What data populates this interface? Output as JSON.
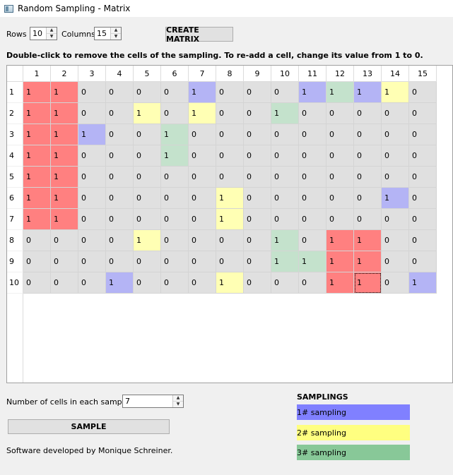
{
  "window": {
    "title": "Random Sampling - Matrix"
  },
  "controls": {
    "rows_label": "Rows",
    "rows_value": "10",
    "columns_label": "Columns",
    "columns_value": "15",
    "create_button": "CREATE MATRIX"
  },
  "instruction": "Double-click to remove the cells of the sampling. To re-add a cell, change its value from 1 to 0.",
  "table": {
    "column_headers": [
      "1",
      "2",
      "3",
      "4",
      "5",
      "6",
      "7",
      "8",
      "9",
      "10",
      "11",
      "12",
      "13",
      "14",
      "15"
    ],
    "row_headers": [
      "1",
      "2",
      "3",
      "4",
      "5",
      "6",
      "7",
      "8",
      "9",
      "10"
    ],
    "values": [
      [
        "1",
        "1",
        "0",
        "0",
        "0",
        "0",
        "1",
        "0",
        "0",
        "0",
        "1",
        "1",
        "1",
        "1",
        "0"
      ],
      [
        "1",
        "1",
        "0",
        "0",
        "1",
        "0",
        "1",
        "0",
        "0",
        "1",
        "0",
        "0",
        "0",
        "0",
        "0"
      ],
      [
        "1",
        "1",
        "1",
        "0",
        "0",
        "1",
        "0",
        "0",
        "0",
        "0",
        "0",
        "0",
        "0",
        "0",
        "0"
      ],
      [
        "1",
        "1",
        "0",
        "0",
        "0",
        "1",
        "0",
        "0",
        "0",
        "0",
        "0",
        "0",
        "0",
        "0",
        "0"
      ],
      [
        "1",
        "1",
        "0",
        "0",
        "0",
        "0",
        "0",
        "0",
        "0",
        "0",
        "0",
        "0",
        "0",
        "0",
        "0"
      ],
      [
        "1",
        "1",
        "0",
        "0",
        "0",
        "0",
        "0",
        "1",
        "0",
        "0",
        "0",
        "0",
        "0",
        "1",
        "0"
      ],
      [
        "1",
        "1",
        "0",
        "0",
        "0",
        "0",
        "0",
        "1",
        "0",
        "0",
        "0",
        "0",
        "0",
        "0",
        "0"
      ],
      [
        "0",
        "0",
        "0",
        "0",
        "1",
        "0",
        "0",
        "0",
        "0",
        "1",
        "0",
        "1",
        "1",
        "0",
        "0"
      ],
      [
        "0",
        "0",
        "0",
        "0",
        "0",
        "0",
        "0",
        "0",
        "0",
        "1",
        "1",
        "1",
        "1",
        "0",
        "0"
      ],
      [
        "0",
        "0",
        "0",
        "1",
        "0",
        "0",
        "0",
        "1",
        "0",
        "0",
        "0",
        "1",
        "1",
        "0",
        "1"
      ]
    ],
    "colors": [
      [
        "R",
        "R",
        "",
        "",
        "",
        "",
        "B",
        "",
        "",
        "",
        "B",
        "G",
        "B",
        "Y",
        ""
      ],
      [
        "R",
        "R",
        "",
        "",
        "Y",
        "",
        "Y",
        "",
        "",
        "G",
        "",
        "",
        "",
        "",
        ""
      ],
      [
        "R",
        "R",
        "B",
        "",
        "",
        "G",
        "",
        "",
        "",
        "",
        "",
        "",
        "",
        "",
        ""
      ],
      [
        "R",
        "R",
        "",
        "",
        "",
        "G",
        "",
        "",
        "",
        "",
        "",
        "",
        "",
        "",
        ""
      ],
      [
        "R",
        "R",
        "",
        "",
        "",
        "",
        "",
        "",
        "",
        "",
        "",
        "",
        "",
        "",
        ""
      ],
      [
        "R",
        "R",
        "",
        "",
        "",
        "",
        "",
        "Y",
        "",
        "",
        "",
        "",
        "",
        "B",
        ""
      ],
      [
        "R",
        "R",
        "",
        "",
        "",
        "",
        "",
        "Y",
        "",
        "",
        "",
        "",
        "",
        "",
        ""
      ],
      [
        "",
        "",
        "",
        "",
        "Y",
        "",
        "",
        "",
        "",
        "G",
        "",
        "R",
        "R",
        "",
        ""
      ],
      [
        "",
        "",
        "",
        "",
        "",
        "",
        "",
        "",
        "",
        "G",
        "G",
        "R",
        "R",
        "",
        ""
      ],
      [
        "",
        "",
        "",
        "B",
        "",
        "",
        "",
        "Y",
        "",
        "",
        "",
        "R",
        "R",
        "",
        "B"
      ]
    ],
    "palette": {
      "R": "#ff8080",
      "B": "#b4b4f5",
      "Y": "#ffffb4",
      "G": "#c4e2cc",
      "default": "#e0e0e0"
    },
    "selected_cell": [
      9,
      12
    ]
  },
  "sampling": {
    "label": "Number of cells in each sampling:",
    "value": "7",
    "button": "SAMPLE"
  },
  "credits": "Software developed by Monique Schreiner.",
  "legend": {
    "title": "SAMPLINGS",
    "items": [
      {
        "label": "1# sampling",
        "color": "#8080ff"
      },
      {
        "label": "2# sampling",
        "color": "#ffff80"
      },
      {
        "label": "3# sampling",
        "color": "#88c898"
      }
    ]
  }
}
